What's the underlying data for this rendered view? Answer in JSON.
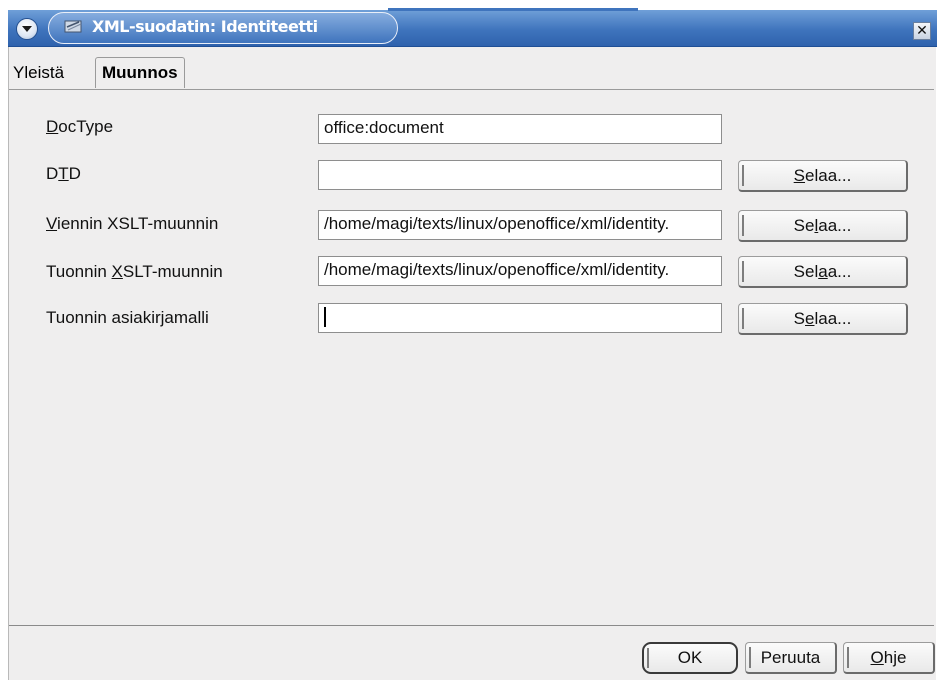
{
  "window": {
    "title": "XML-suodatin: Identiteetti",
    "close_glyph": "✕",
    "menu_icon": "chevron-down-circle-icon",
    "app_icon": "xml-filter-icon"
  },
  "tabs": [
    {
      "label": "Yleistä",
      "active": false
    },
    {
      "label": "Muunnos",
      "active": true
    }
  ],
  "form": {
    "doctype": {
      "label_underline": "D",
      "label_rest": "ocType",
      "value": "office:document"
    },
    "dtd": {
      "label_pre": "D",
      "label_underline": "T",
      "label_rest": "D",
      "value": "",
      "button_underline": "S",
      "button_rest": "elaa..."
    },
    "export_xslt": {
      "label_underline": "V",
      "label_rest": "iennin XSLT-muunnin",
      "value": "/home/magi/texts/linux/openoffice/xml/identity.",
      "button_pre": "Se",
      "button_underline": "l",
      "button_rest": "aa..."
    },
    "import_xslt": {
      "label_pre": "Tuonnin ",
      "label_underline": "X",
      "label_rest": "SLT-muunnin",
      "value": "/home/magi/texts/linux/openoffice/xml/identity.",
      "button_pre": "Sel",
      "button_underline": "a",
      "button_rest": "a..."
    },
    "import_template": {
      "label": "Tuonnin asiakirjamalli",
      "value": "",
      "button_pre": "S",
      "button_underline": "e",
      "button_rest": "laa..."
    }
  },
  "footer": {
    "ok_label": "OK",
    "cancel_label": "Peruuta",
    "help_underline": "O",
    "help_rest": "hje"
  },
  "colors": {
    "titlebar": "#3f74bd",
    "dialog_bg": "#efeeee"
  }
}
